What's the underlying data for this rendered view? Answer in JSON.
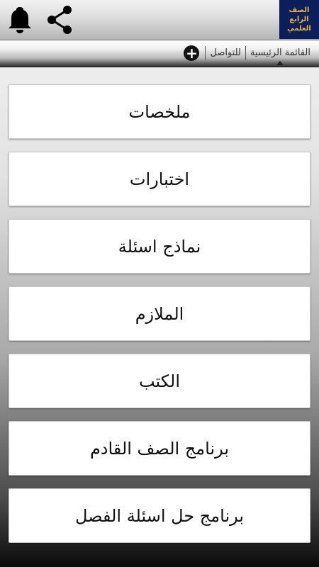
{
  "app": {
    "logo_line1": "الصف",
    "logo_line2": "الرابع العلمي"
  },
  "icons": {
    "notification": "bell-icon",
    "share": "share-icon",
    "add": "plus-circle-icon"
  },
  "tabs": {
    "home": "القائمة الرئيسية",
    "contact": "للتواصل"
  },
  "menu": {
    "items": [
      {
        "label": "ملخصات"
      },
      {
        "label": "اختبارات"
      },
      {
        "label": "نماذج اسئلة"
      },
      {
        "label": "الملازم"
      },
      {
        "label": "الكتب"
      },
      {
        "label": "برنامج الصف القادم"
      },
      {
        "label": "برنامج حل اسئلة الفصل"
      }
    ]
  },
  "colors": {
    "logo_bg": "#0c1f5a",
    "logo_text": "#e8b640"
  }
}
